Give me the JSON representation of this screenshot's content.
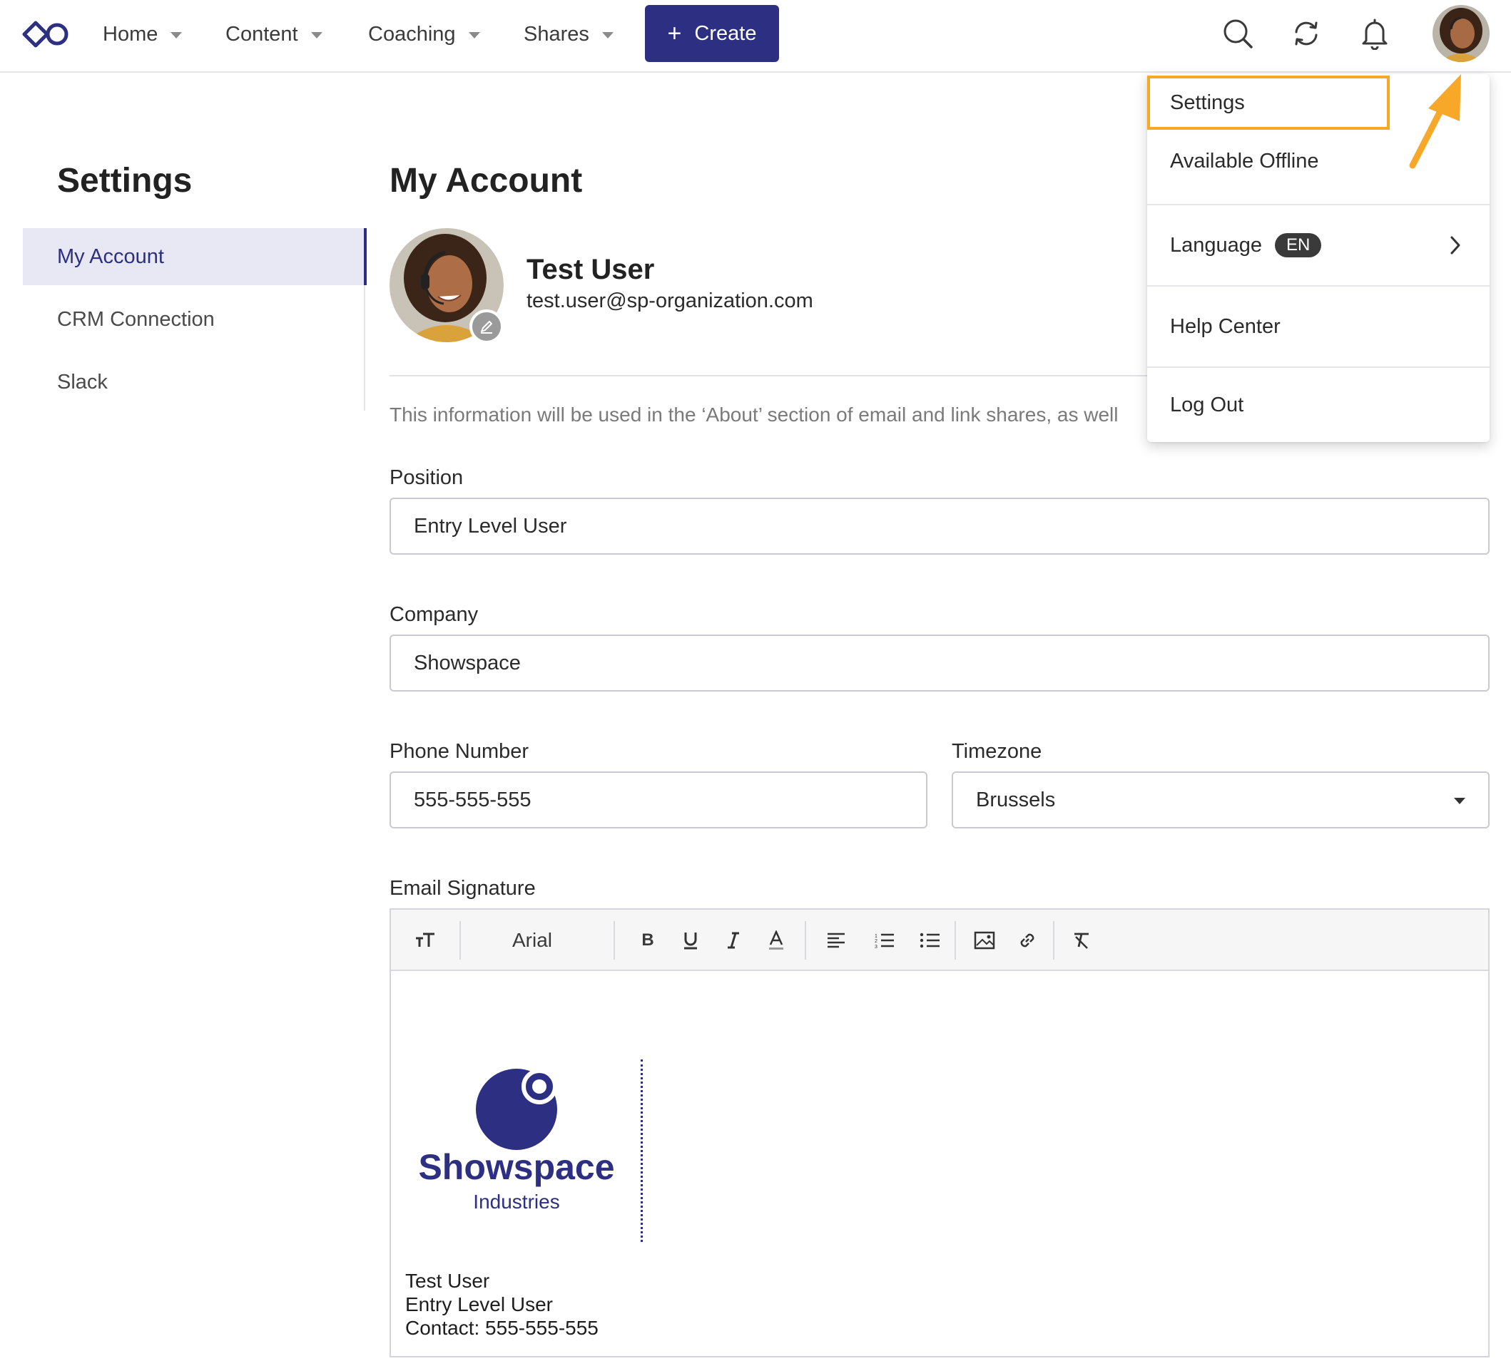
{
  "nav": {
    "items": [
      {
        "label": "Home"
      },
      {
        "label": "Content"
      },
      {
        "label": "Coaching"
      },
      {
        "label": "Shares"
      }
    ],
    "create_label": "Create",
    "icons": [
      "search-icon",
      "sync-icon",
      "bell-icon",
      "avatar"
    ]
  },
  "sidebar": {
    "title": "Settings",
    "items": [
      {
        "label": "My Account",
        "active": true
      },
      {
        "label": "CRM Connection",
        "active": false
      },
      {
        "label": "Slack",
        "active": false
      }
    ]
  },
  "main": {
    "title": "My Account",
    "user": {
      "name": "Test User",
      "email": "test.user@sp-organization.com"
    },
    "info_text": "This information will be used in the ‘About’ section of email and link shares, as well",
    "fields": {
      "position": {
        "label": "Position",
        "value": "Entry Level User"
      },
      "company": {
        "label": "Company",
        "value": "Showspace"
      },
      "phone": {
        "label": "Phone Number",
        "value": "555-555-555"
      },
      "timezone": {
        "label": "Timezone",
        "value": "Brussels"
      }
    },
    "signature": {
      "label": "Email Signature",
      "font": "Arial",
      "logo_title": "Showspace",
      "logo_subtitle": "Industries",
      "lines": [
        "Test User",
        "Entry Level User",
        "Contact: 555-555-555"
      ]
    }
  },
  "menu": {
    "settings": "Settings",
    "offline": "Available Offline",
    "language": "Language",
    "language_code": "EN",
    "help": "Help Center",
    "logout": "Log Out"
  },
  "colors": {
    "brand": "#2d2f83",
    "highlight": "#f7a829",
    "active_bg": "#e8e8f4"
  }
}
